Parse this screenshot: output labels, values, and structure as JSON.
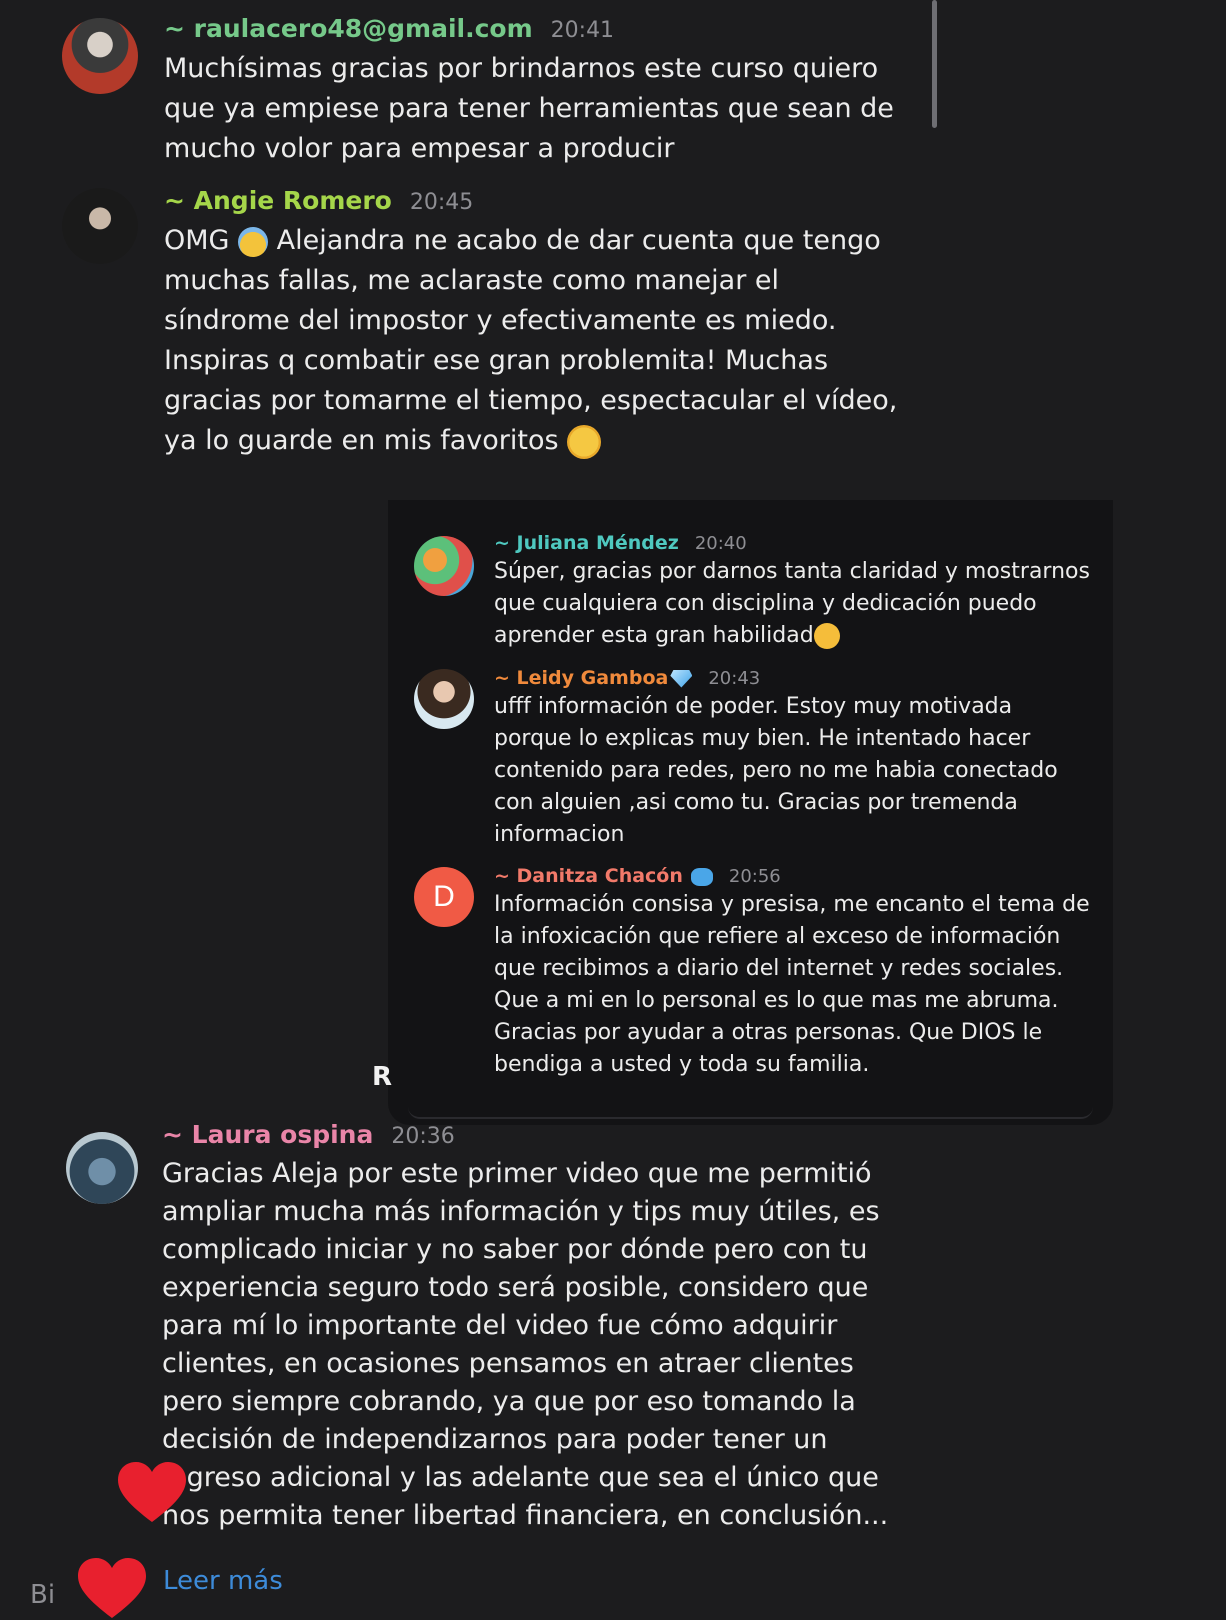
{
  "messages": [
    {
      "sender": "~ raulacero48@gmail.com",
      "time": "20:41",
      "text": "Muchísimas gracias por brindarnos este curso quiero\nque ya empiese para tener herramientas que sean de\nmucho volor para empesar a producir",
      "color": "#76c98a"
    },
    {
      "sender": "~ Angie Romero",
      "time": "20:45",
      "text_part1": "OMG ",
      "text_part2": " Alejandra ne acabo de dar cuenta que tengo\nmuchas fallas, me aclaraste como manejar el\nsíndrome del impostor y efectivamente es miedo.\nInspiras q combatir ese gran problemita! Muchas\ngracias por tomarme el tiempo, espectacular el vídeo,\nya lo guarde en mis favoritos ",
      "color": "#a5d64a",
      "emoji1": "screaming-face-emoji",
      "emoji2": "partying-face-emoji"
    }
  ],
  "card": {
    "messages": [
      {
        "sender": "~ Juliana Méndez",
        "time": "20:40",
        "text": "Súper, gracias por darnos tanta claridad y mostrarnos\nque cualquiera con disciplina y dedicación puedo\naprender esta gran habilidad",
        "color": "#4fc9c0",
        "emoji": "smiling-face-emoji"
      },
      {
        "sender": "~ Leidy Gamboa",
        "time": "20:43",
        "text": "ufff información de poder. Estoy muy motivada\nporque lo explicas muy bien. He intentado hacer\ncontenido para redes, pero no me habia conectado\ncon alguien ,asi como tu. Gracias por tremenda\ninformacion",
        "color": "#f08a3c",
        "emoji": "gem-emoji"
      },
      {
        "sender": "~ Danitza Chacón",
        "time": "20:56",
        "text": "Información consisa y presisa, me encanto el tema de\nla infoxicación que  refiere al exceso de información\nque recibimos a diario  del internet y redes sociales.\nQue a mi en lo personal es lo que mas me abruma.\nGracias por ayudar a otras personas. Que DIOS le\nbendiga a usted y toda su familia.",
        "color": "#f27a6a",
        "avatar_letter": "D",
        "avatar_color": "#f05a45",
        "emoji": "butterfly-emoji"
      }
    ]
  },
  "stray_letter": "R",
  "bottom_message": {
    "sender": "~ Laura ospina",
    "time": "20:36",
    "text": "Gracias Aleja por este primer video que me permitió\nampliar mucha más información y tips muy útiles, es\ncomplicado iniciar y no saber por dónde pero con tu\nexperiencia seguro todo será posible, considero que\npara mí lo importante del video fue cómo adquirir\nclientes, en ocasiones pensamos en atraer clientes\npero siempre cobrando, ya que por eso tomando la\ndecisión de independizarnos para poder tener un\ningreso adicional y las adelante que sea el único que\nnos permita tener libertad financiera, en conclusión...",
    "color": "#e985a8"
  },
  "read_more": "Leer más",
  "corner_text": "Bi",
  "heart_color": "#e8202e"
}
